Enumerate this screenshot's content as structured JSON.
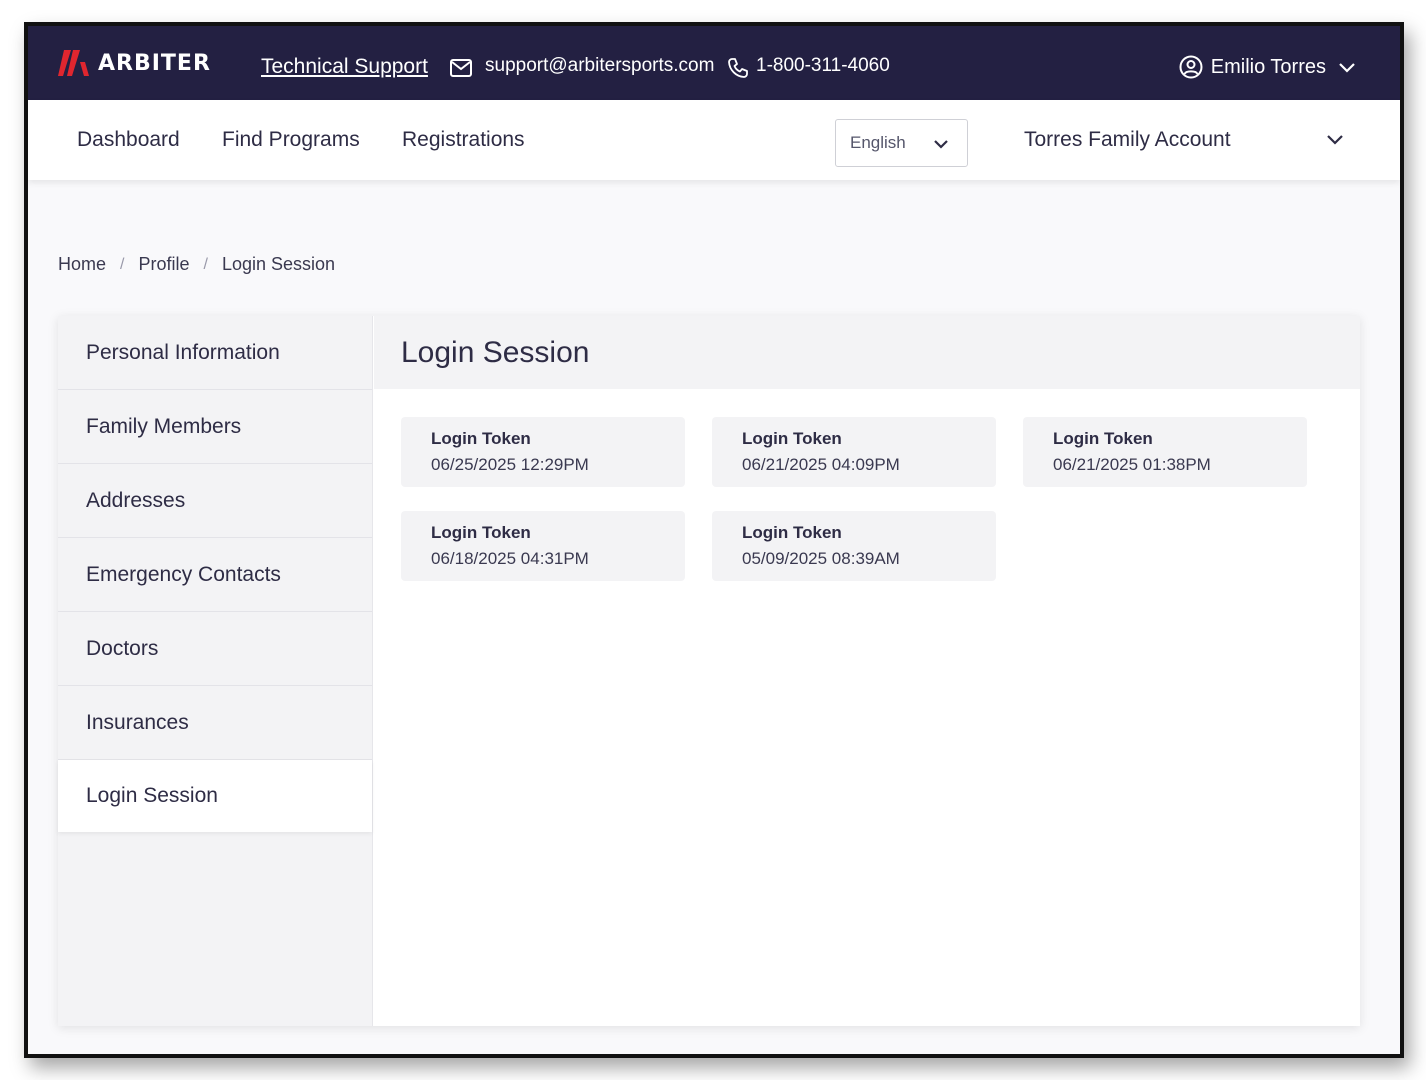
{
  "header": {
    "brand": "ARBITER",
    "support_link": "Technical Support",
    "email": "support@arbitersports.com",
    "phone": "1-800-311-4060",
    "user_name": "Emilio Torres",
    "brand_color": "#e0262f",
    "bar_color": "#232042"
  },
  "nav": {
    "items": [
      {
        "label": "Dashboard"
      },
      {
        "label": "Find Programs"
      },
      {
        "label": "Registrations"
      }
    ],
    "language": "English",
    "account": "Torres Family Account"
  },
  "breadcrumb": {
    "items": [
      "Home",
      "Profile",
      "Login Session"
    ],
    "separator": "/"
  },
  "sidebar": {
    "items": [
      {
        "label": "Personal Information"
      },
      {
        "label": "Family Members"
      },
      {
        "label": "Addresses"
      },
      {
        "label": "Emergency Contacts"
      },
      {
        "label": "Doctors"
      },
      {
        "label": "Insurances"
      },
      {
        "label": "Login Session"
      }
    ],
    "active": "Login Session"
  },
  "main": {
    "title": "Login Session",
    "tokens": [
      {
        "label": "Login Token",
        "date": "06/25/2025 12:29PM"
      },
      {
        "label": "Login Token",
        "date": "06/21/2025 04:09PM"
      },
      {
        "label": "Login Token",
        "date": "06/21/2025 01:38PM"
      },
      {
        "label": "Login Token",
        "date": "06/18/2025 04:31PM"
      },
      {
        "label": "Login Token",
        "date": "05/09/2025 08:39AM"
      }
    ]
  }
}
